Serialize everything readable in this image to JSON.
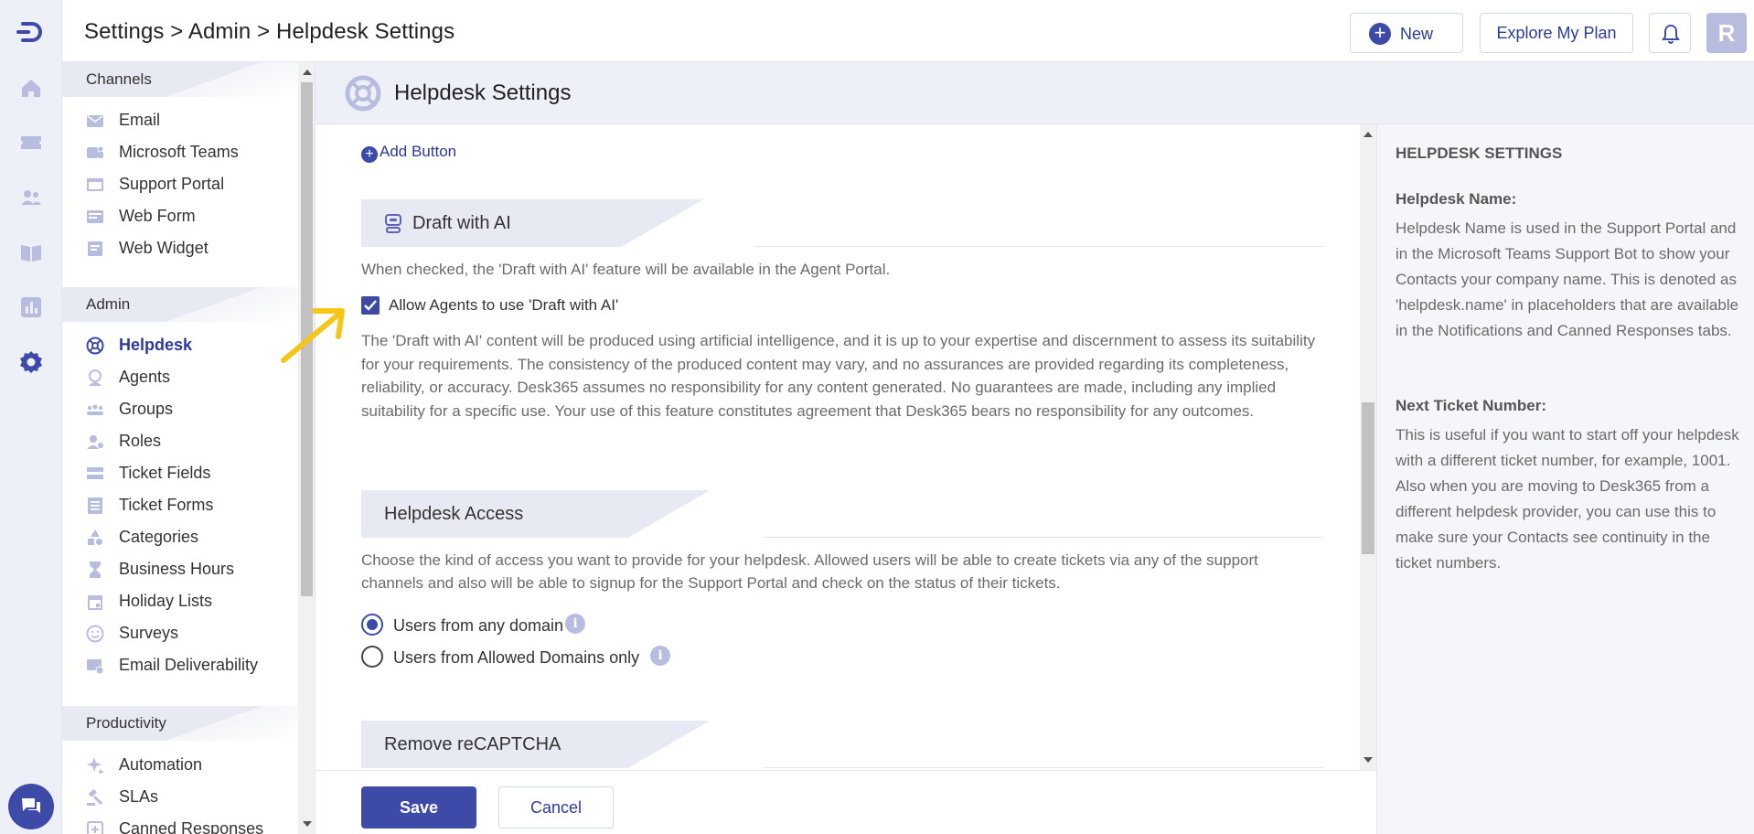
{
  "breadcrumb": "Settings > Admin > Helpdesk Settings",
  "header": {
    "new_label": "New",
    "plan_label": "Explore My Plan",
    "avatar_initial": "R"
  },
  "sidebar": {
    "channels_title": "Channels",
    "channels": [
      "Email",
      "Microsoft Teams",
      "Support Portal",
      "Web Form",
      "Web Widget"
    ],
    "admin_title": "Admin",
    "admin": [
      "Helpdesk",
      "Agents",
      "Groups",
      "Roles",
      "Ticket Fields",
      "Ticket Forms",
      "Categories",
      "Business Hours",
      "Holiday Lists",
      "Surveys",
      "Email Deliverability"
    ],
    "productivity_title": "Productivity",
    "productivity": [
      "Automation",
      "SLAs",
      "Canned Responses"
    ]
  },
  "page": {
    "title": "Helpdesk Settings",
    "add_button": "Add Button",
    "draft": {
      "title": "Draft with AI",
      "desc": "When checked, the 'Draft with AI' feature will be available in the Agent Portal.",
      "checkbox_label": "Allow Agents to use 'Draft with AI'",
      "checked": true,
      "disclaimer": "The 'Draft with AI' content will be produced using artificial intelligence, and it is up to your expertise and discernment to assess its suitability for your requirements. The consistency of the produced content may vary, and no assurances are provided regarding its completeness, reliability, or accuracy. Desk365 assumes no responsibility for any content generated. No guarantees are made, including any implied suitability for a specific use. Your use of this feature constitutes agreement that Desk365 bears no responsibility for any outcomes."
    },
    "access": {
      "title": "Helpdesk Access",
      "desc": "Choose the kind of access you want to provide for your helpdesk. Allowed users will be able to create tickets via any of the support channels and also will be able to signup for the Support Portal and check on the status of their tickets.",
      "option_any": "Users from any domain",
      "option_allowed": "Users from Allowed Domains only",
      "selected": "any"
    },
    "recaptcha": {
      "title": "Remove reCAPTCHA"
    }
  },
  "footer": {
    "save_label": "Save",
    "cancel_label": "Cancel"
  },
  "help": {
    "title": "HELPDESK SETTINGS",
    "name_title": "Helpdesk Name:",
    "name_text": "Helpdesk Name is used in the Support Portal and in the Microsoft Teams Support Bot to show your Contacts your company name. This is denoted as 'helpdesk.name' in placeholders that are available in the Notifications and Canned Responses tabs.",
    "ticket_title": "Next Ticket Number:",
    "ticket_text": "This is useful if you want to start off your helpdesk with a different ticket number, for example, 1001. Also when you are moving to Desk365 from a different helpdesk provider, you can use this to make sure your Contacts see continuity in the ticket numbers."
  },
  "colors": {
    "accent": "#3d4aa8",
    "icon_muted": "#b8bde0",
    "arrow": "#f5c518"
  }
}
